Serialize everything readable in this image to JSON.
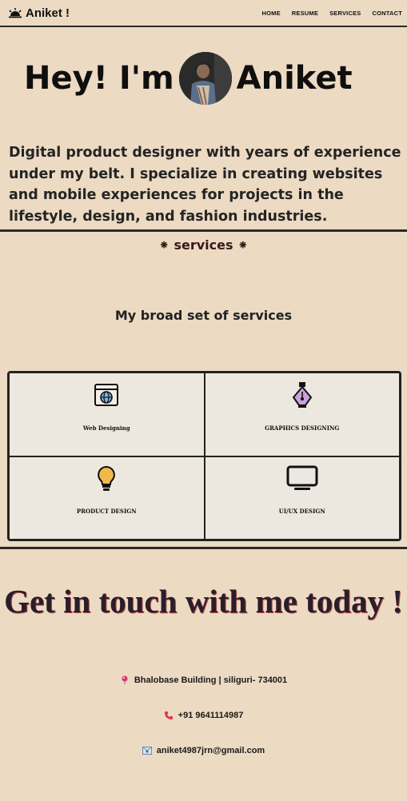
{
  "nav": {
    "brand": "Aniket !",
    "links": [
      "HOME",
      "RESUME",
      "SERVICES",
      "CONTACT"
    ]
  },
  "hero": {
    "title_left": "Hey! I'm",
    "title_right": "Aniket",
    "description": "Digital product designer with years of experience under my belt. I specialize in creating websites and mobile experiences for projects in the lifestyle, design, and fashion industries."
  },
  "services": {
    "heading": "⁕ services ⁕",
    "subtitle": "My broad set of services",
    "items": [
      {
        "label": "Web Designing",
        "icon": "globe-window-icon"
      },
      {
        "label": "GRAPHICS DESIGNING",
        "icon": "pen-nib-icon"
      },
      {
        "label": "PRODUCT DESIGN",
        "icon": "lightbulb-icon"
      },
      {
        "label": "UI/UX DESIGN",
        "icon": "monitor-icon"
      }
    ]
  },
  "contact": {
    "title": "Get in touch with me today !",
    "address": "Bhalobase Building | siliguri- 734001",
    "phone": "+91 9641114987",
    "email": "aniket4987jrn@gmail.com"
  },
  "colors": {
    "background": "#ecdac3",
    "card_background": "#ede8df",
    "accent_pen": "#c9a0dc",
    "accent_bulb": "#f2b84b",
    "contact_title_shadow": "#b04848"
  }
}
